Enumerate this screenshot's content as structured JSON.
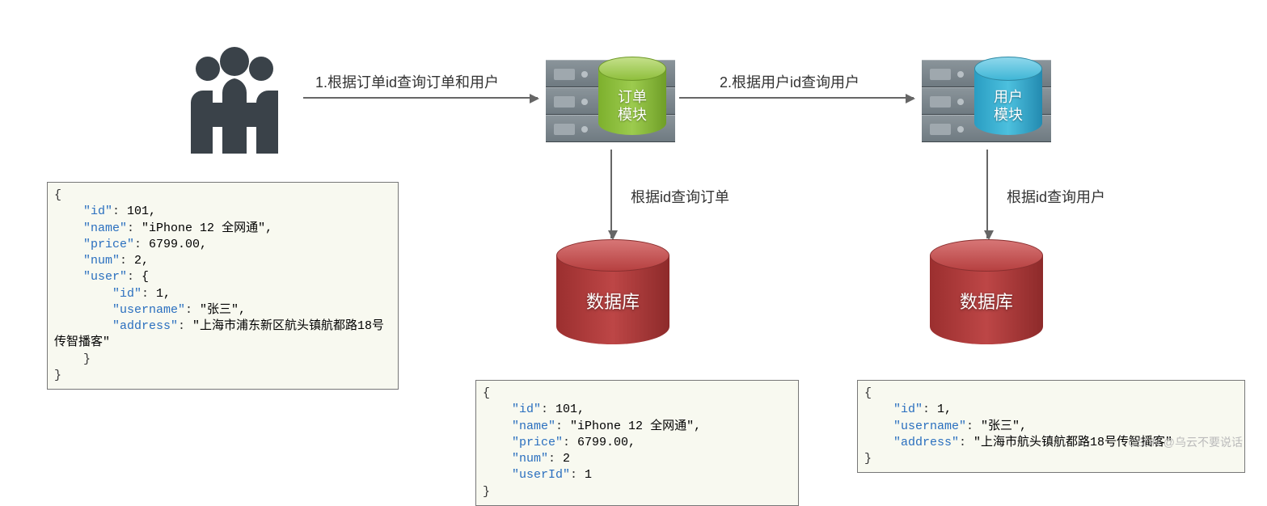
{
  "arrows": {
    "a1_label": "1.根据订单id查询订单和用户",
    "a2_label": "2.根据用户id查询用户",
    "down_order_label": "根据id查询订单",
    "down_user_label": "根据id查询用户"
  },
  "modules": {
    "order": {
      "line1": "订单",
      "line2": "模块"
    },
    "user": {
      "line1": "用户",
      "line2": "模块"
    }
  },
  "db_label": "数据库",
  "code": {
    "merged": "{\n    \"id\": 101,\n    \"name\": \"iPhone 12 全网通\",\n    \"price\": 6799.00,\n    \"num\": 2,\n    \"user\": {\n        \"id\": 1,\n        \"username\": \"张三\",\n        \"address\": \"上海市浦东新区航头镇航都路18号传智播客\"\n    }\n}",
    "order": "{\n    \"id\": 101,\n    \"name\": \"iPhone 12 全网通\",\n    \"price\": 6799.00,\n    \"num\": 2\n    \"userId\": 1\n}",
    "user": "{\n    \"id\": 1,\n    \"username\": \"张三\",\n    \"address\": \"上海市航头镇航都路18号传智播客\"\n}"
  },
  "chart_data": {
    "type": "diagram",
    "flow": [
      {
        "from": "client",
        "to": "order-module",
        "label": "1.根据订单id查询订单和用户"
      },
      {
        "from": "order-module",
        "to": "user-module",
        "label": "2.根据用户id查询用户"
      },
      {
        "from": "order-module",
        "to": "order-db",
        "label": "根据id查询订单"
      },
      {
        "from": "user-module",
        "to": "user-db",
        "label": "根据id查询用户"
      }
    ],
    "responses": {
      "merged_to_client": {
        "id": 101,
        "name": "iPhone 12 全网通",
        "price": 6799.0,
        "num": 2,
        "user": {
          "id": 1,
          "username": "张三",
          "address": "上海市浦东新区航头镇航都路18号传智播客"
        }
      },
      "order_db_row": {
        "id": 101,
        "name": "iPhone 12 全网通",
        "price": 6799.0,
        "num": 2,
        "userId": 1
      },
      "user_db_row": {
        "id": 1,
        "username": "张三",
        "address": "上海市航头镇航都路18号传智播客"
      }
    }
  },
  "watermark": "CSDN @乌云不要说话"
}
